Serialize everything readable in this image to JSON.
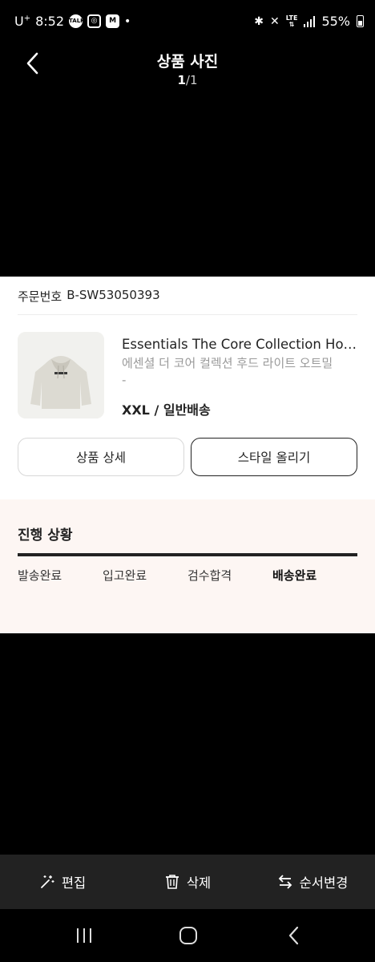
{
  "status_bar": {
    "carrier": "U",
    "carrier_sup": "+",
    "time": "8:52",
    "notification_icons": [
      "talk-icon",
      "instagram-icon",
      "gmail-icon"
    ],
    "network": "LTE",
    "battery": "55%"
  },
  "header": {
    "title": "상품 사진",
    "counter_current": "1",
    "counter_sep": "/",
    "counter_total": "1"
  },
  "order": {
    "label": "주문번호",
    "number": "B-SW53050393"
  },
  "product": {
    "name": "Essentials The Core Collection Hoodie Light Oatmeal",
    "name_kr": "에센셜 더 코어 컬렉션 후드 라이트 오트밀",
    "name_extra": "-",
    "option": "XXL / 일반배송"
  },
  "buttons": {
    "detail": "상품 상세",
    "style": "스타일 올리기"
  },
  "progress": {
    "title": "진행 상황",
    "steps": [
      "발송완료",
      "입고완료",
      "검수합격",
      "배송완료"
    ],
    "active_step": "배송완료",
    "fill": 1.0
  },
  "toolbar": {
    "edit": "편집",
    "delete": "삭제",
    "reorder": "순서변경"
  },
  "colors": {
    "background": "#000000",
    "card": "#ffffff",
    "progress_bg": "#fdf6f3",
    "toolbar": "#222222"
  }
}
